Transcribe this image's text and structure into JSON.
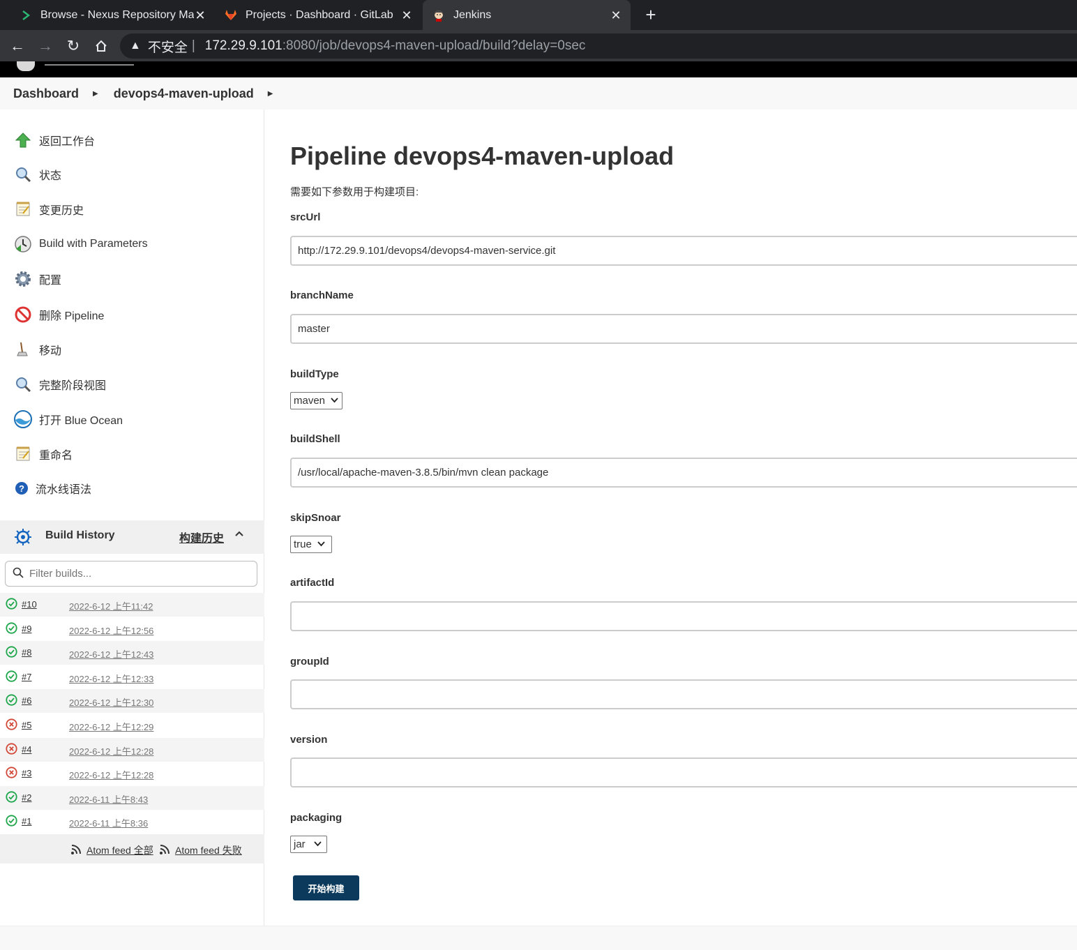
{
  "browser": {
    "tabs": [
      {
        "title": "Browse - Nexus Repository Ma",
        "icon": "nexus-icon"
      },
      {
        "title": "Projects · Dashboard · GitLab",
        "icon": "gitlab-icon"
      },
      {
        "title": "Jenkins",
        "icon": "jenkins-icon"
      }
    ],
    "new_tab": "+",
    "insecure_label": "不安全",
    "separator": "|",
    "url_host": "172.29.9.101",
    "url_path": ":8080/job/devops4-maven-upload/build?delay=0sec"
  },
  "breadcrumb": [
    "Dashboard",
    "devops4-maven-upload"
  ],
  "sidebar": {
    "tasks": [
      {
        "label": "返回工作台",
        "icon": "up-arrow-icon"
      },
      {
        "label": "状态",
        "icon": "magnifier-icon"
      },
      {
        "label": "变更历史",
        "icon": "notepad-icon"
      },
      {
        "label": "Build with Parameters",
        "icon": "clock-icon"
      },
      {
        "label": "配置",
        "icon": "gear-icon"
      },
      {
        "label": "删除 Pipeline",
        "icon": "no-entry-icon"
      },
      {
        "label": "移动",
        "icon": "move-icon"
      },
      {
        "label": "完整阶段视图",
        "icon": "magnifier-icon"
      },
      {
        "label": "打开 Blue Ocean",
        "icon": "blue-ocean-icon"
      },
      {
        "label": "重命名",
        "icon": "notepad-icon"
      },
      {
        "label": "流水线语法",
        "icon": "help-icon"
      }
    ]
  },
  "build_history": {
    "title": "Build History",
    "link": "构建历史",
    "filter_placeholder": "Filter builds...",
    "builds": [
      {
        "num": "#10",
        "date": "2022-6-12 上午11:42",
        "status": "success"
      },
      {
        "num": "#9",
        "date": "2022-6-12 上午12:56",
        "status": "success"
      },
      {
        "num": "#8",
        "date": "2022-6-12 上午12:43",
        "status": "success"
      },
      {
        "num": "#7",
        "date": "2022-6-12 上午12:33",
        "status": "success"
      },
      {
        "num": "#6",
        "date": "2022-6-12 上午12:30",
        "status": "success"
      },
      {
        "num": "#5",
        "date": "2022-6-12 上午12:29",
        "status": "failed"
      },
      {
        "num": "#4",
        "date": "2022-6-12 上午12:28",
        "status": "failed"
      },
      {
        "num": "#3",
        "date": "2022-6-12 上午12:28",
        "status": "failed"
      },
      {
        "num": "#2",
        "date": "2022-6-11 上午8:43",
        "status": "success"
      },
      {
        "num": "#1",
        "date": "2022-6-11 上午8:36",
        "status": "success"
      }
    ],
    "feed_all": "Atom feed 全部",
    "feed_failed": "Atom feed 失败"
  },
  "main": {
    "title": "Pipeline devops4-maven-upload",
    "subtitle": "需要如下参数用于构建项目:",
    "params": {
      "srcUrl": {
        "label": "srcUrl",
        "value": "http://172.29.9.101/devops4/devops4-maven-service.git"
      },
      "branchName": {
        "label": "branchName",
        "value": "master"
      },
      "buildType": {
        "label": "buildType",
        "value": "maven"
      },
      "buildShell": {
        "label": "buildShell",
        "value": "/usr/local/apache-maven-3.8.5/bin/mvn clean package"
      },
      "skipSnoar": {
        "label": "skipSnoar",
        "value": "true"
      },
      "artifactId": {
        "label": "artifactId",
        "value": ""
      },
      "groupId": {
        "label": "groupId",
        "value": ""
      },
      "version": {
        "label": "version",
        "value": ""
      },
      "packaging": {
        "label": "packaging",
        "value": "jar"
      }
    },
    "build_button": "开始构建"
  },
  "colors": {
    "success": "#1ea64b",
    "failed": "#d24939",
    "build_button": "#0b3a5c"
  }
}
